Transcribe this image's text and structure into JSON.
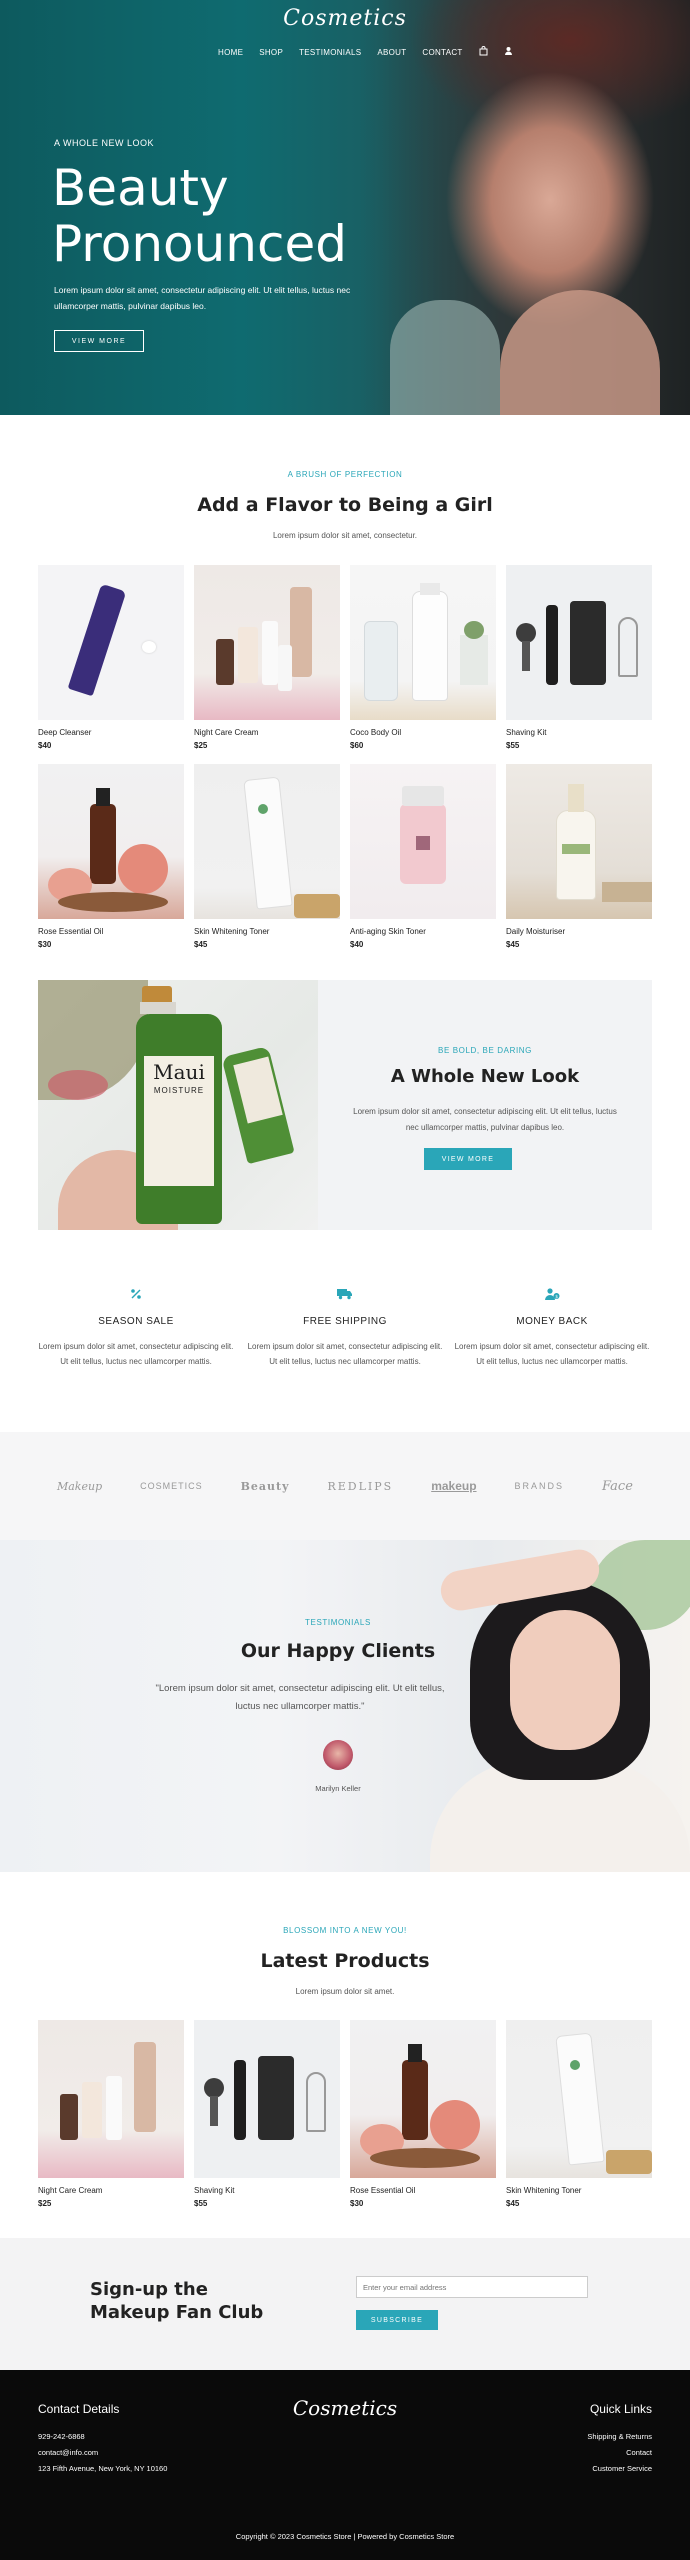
{
  "brand": {
    "logo": "Cosmetics"
  },
  "nav": {
    "items": [
      "HOME",
      "SHOP",
      "TESTIMONIALS",
      "ABOUT",
      "CONTACT"
    ],
    "cart_icon": "cart-icon",
    "user_icon": "user-icon"
  },
  "hero": {
    "eyebrow": "A WHOLE NEW LOOK",
    "title_line1": "Beauty",
    "title_line2": "Pronounced",
    "text": "Lorem ipsum dolor sit amet, consectetur adipiscing elit. Ut elit tellus, luctus nec ullamcorper mattis, pulvinar dapibus leo.",
    "button": "VIEW MORE"
  },
  "collection": {
    "eyebrow": "A BRUSH OF PERFECTION",
    "title": "Add a Flavor to Being a Girl",
    "subtitle": "Lorem ipsum dolor sit amet, consectetur.",
    "products": [
      {
        "name": "Deep Cleanser",
        "price": "$40"
      },
      {
        "name": "Night Care Cream",
        "price": "$25"
      },
      {
        "name": "Coco Body Oil",
        "price": "$60"
      },
      {
        "name": "Shaving Kit",
        "price": "$55"
      },
      {
        "name": "Rose Essential Oil",
        "price": "$30"
      },
      {
        "name": "Skin Whitening Toner",
        "price": "$45"
      },
      {
        "name": "Anti-aging Skin Toner",
        "price": "$40"
      },
      {
        "name": "Daily Moisturiser",
        "price": "$45"
      }
    ]
  },
  "feature": {
    "eyebrow": "BE BOLD, BE DARING",
    "title": "A Whole New Look",
    "text": "Lorem ipsum dolor sit amet, consectetur adipiscing elit. Ut elit tellus, luctus nec ullamcorper mattis, pulvinar dapibus leo.",
    "button": "VIEW MORE",
    "bottle_brand": "Maui",
    "bottle_sub": "MOISTURE"
  },
  "services": [
    {
      "icon": "percent-icon",
      "title": "SEASON SALE",
      "text": "Lorem ipsum dolor sit amet, consectetur adipiscing elit. Ut elit tellus, luctus nec ullamcorper mattis."
    },
    {
      "icon": "truck-icon",
      "title": "FREE SHIPPING",
      "text": "Lorem ipsum dolor sit amet, consectetur adipiscing elit. Ut elit tellus, luctus nec ullamcorper mattis."
    },
    {
      "icon": "user-dollar-icon",
      "title": "MONEY BACK",
      "text": "Lorem ipsum dolor sit amet, consectetur adipiscing elit. Ut elit tellus, luctus nec ullamcorper mattis."
    }
  ],
  "brands": [
    "Makeup",
    "COSMETICS",
    "Beauty",
    "REDLIPS",
    "makeup",
    "BRANDS",
    "Face"
  ],
  "testimonials": {
    "eyebrow": "TESTIMONIALS",
    "title": "Our Happy Clients",
    "quote": "\"Lorem ipsum dolor sit amet, consectetur adipiscing elit. Ut elit tellus, luctus nec ullamcorper mattis.\"",
    "author": "Marilyn Keller"
  },
  "latest": {
    "eyebrow": "BLOSSOM INTO A NEW YOU!",
    "title": "Latest Products",
    "subtitle": "Lorem ipsum dolor sit amet.",
    "products": [
      {
        "name": "Night Care Cream",
        "price": "$25"
      },
      {
        "name": "Shaving Kit",
        "price": "$55"
      },
      {
        "name": "Rose Essential Oil",
        "price": "$30"
      },
      {
        "name": "Skin Whitening Toner",
        "price": "$45"
      }
    ]
  },
  "newsletter": {
    "title_line1": "Sign-up the",
    "title_line2": "Makeup Fan Club",
    "placeholder": "Enter your email address",
    "button": "SUBSCRIBE"
  },
  "footer": {
    "contact_title": "Contact Details",
    "phone": "929-242-6868",
    "email": "contact@info.com",
    "address": "123 Fifth Avenue, New York, NY 10160",
    "logo": "Cosmetics",
    "links_title": "Quick Links",
    "links": [
      "Shipping & Returns",
      "Contact",
      "Customer Service"
    ],
    "copyright": "Copyright © 2023 Cosmetics Store | Powered by Cosmetics Store"
  },
  "colors": {
    "accent": "#2aa6b8",
    "hero_bg": "#0f6b70",
    "footer_bg": "#0a0a0a"
  }
}
